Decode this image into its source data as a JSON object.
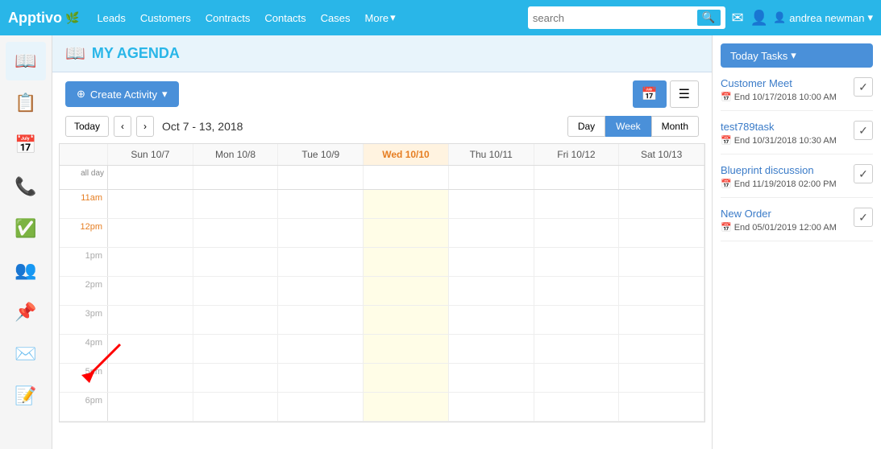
{
  "app": {
    "name": "Apptivo"
  },
  "nav": {
    "links": [
      "Leads",
      "Customers",
      "Contracts",
      "Contacts",
      "Cases"
    ],
    "more_label": "More",
    "search_placeholder": "search",
    "user": "andrea newman"
  },
  "page": {
    "icon": "📖",
    "title": "MY AGENDA"
  },
  "toolbar": {
    "create_label": "Create Activity",
    "create_icon": "+"
  },
  "calendar": {
    "today_label": "Today",
    "range": "Oct 7 - 13, 2018",
    "views": [
      "Day",
      "Week",
      "Month"
    ],
    "active_view": "Week",
    "headers": [
      "",
      "Sun 10/7",
      "Mon 10/8",
      "Tue 10/9",
      "Wed 10/10",
      "Thu 10/11",
      "Fri 10/12",
      "Sat 10/13"
    ],
    "allday_label": "all day",
    "times": [
      "11am",
      "12pm",
      "1pm",
      "2pm",
      "3pm",
      "4pm",
      "5pm",
      "6pm"
    ]
  },
  "today_tasks": {
    "button_label": "Today Tasks",
    "tasks": [
      {
        "title": "Customer Meet",
        "end_label": "End",
        "end_date": "10/17/2018 10:00 AM"
      },
      {
        "title": "test789task",
        "end_label": "End",
        "end_date": "10/31/2018 10:30 AM"
      },
      {
        "title": "Blueprint discussion",
        "end_label": "End",
        "end_date": "11/19/2018 02:00 PM"
      },
      {
        "title": "New Order",
        "end_label": "End",
        "end_date": "05/01/2019 12:00 AM"
      }
    ]
  },
  "sidebar": {
    "items": [
      {
        "icon": "📖",
        "name": "agenda"
      },
      {
        "icon": "📋",
        "name": "list"
      },
      {
        "icon": "📅",
        "name": "calendar"
      },
      {
        "icon": "📞",
        "name": "calls"
      },
      {
        "icon": "✅",
        "name": "tasks"
      },
      {
        "icon": "👥",
        "name": "contacts"
      },
      {
        "icon": "📌",
        "name": "pins"
      },
      {
        "icon": "✉️",
        "name": "mail"
      },
      {
        "icon": "📝",
        "name": "notes"
      }
    ]
  }
}
